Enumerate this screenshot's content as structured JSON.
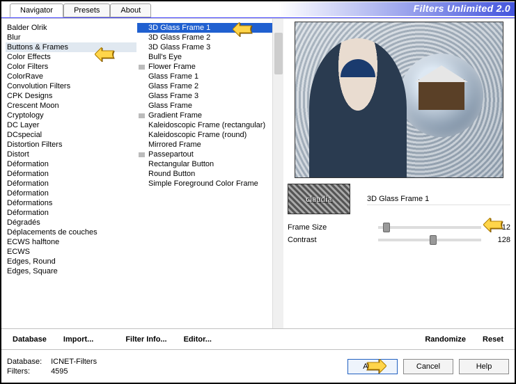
{
  "app": {
    "title": "Filters Unlimited 2.0"
  },
  "tabs": {
    "navigator": "Navigator",
    "presets": "Presets",
    "about": "About"
  },
  "col1_selected_index": 2,
  "col1": [
    "Balder Olrik",
    "Blur",
    "Buttons & Frames",
    "Color Effects",
    "Color Filters",
    "ColorRave",
    "Convolution Filters",
    "CPK Designs",
    "Crescent Moon",
    "Cryptology",
    "DC Layer",
    "DCspecial",
    "Distortion Filters",
    "Distort",
    "Déformation",
    "Déformation",
    "Déformation",
    "Déformation",
    "Déformations",
    "Déformation",
    "Dégradés",
    "Déplacements de couches",
    "ECWS halftone",
    "ECWS",
    "Edges, Round",
    "Edges, Square"
  ],
  "col2_selected_index": 0,
  "col2": [
    {
      "t": "3D Glass Frame 1",
      "sel": true
    },
    {
      "t": "3D Glass Frame 2"
    },
    {
      "t": "3D Glass Frame 3"
    },
    {
      "t": "Bull's Eye"
    },
    {
      "t": "Flower Frame",
      "group": true
    },
    {
      "t": "Glass Frame 1"
    },
    {
      "t": "Glass Frame 2"
    },
    {
      "t": "Glass Frame 3"
    },
    {
      "t": "Glass Frame"
    },
    {
      "t": "Gradient Frame",
      "group": true
    },
    {
      "t": "Kaleidoscopic Frame (rectangular)"
    },
    {
      "t": "Kaleidoscopic Frame (round)"
    },
    {
      "t": "Mirrored Frame"
    },
    {
      "t": "Passepartout",
      "group": true
    },
    {
      "t": "Rectangular Button"
    },
    {
      "t": "Round Button"
    },
    {
      "t": "Simple Foreground Color Frame"
    }
  ],
  "current_filter_name": "3D Glass Frame 1",
  "params": {
    "frame_size": {
      "label": "Frame Size",
      "value": 12,
      "pos_pct": 5
    },
    "contrast": {
      "label": "Contrast",
      "value": 128,
      "pos_pct": 50
    }
  },
  "bottom": {
    "database": "Database",
    "import": "Import...",
    "filter_info": "Filter Info...",
    "editor": "Editor...",
    "randomize": "Randomize",
    "reset": "Reset"
  },
  "status": {
    "db_label": "Database:",
    "db_value": "ICNET-Filters",
    "flt_label": "Filters:",
    "flt_value": "4595"
  },
  "dlg": {
    "apply": "Apply",
    "cancel": "Cancel",
    "help": "Help"
  }
}
